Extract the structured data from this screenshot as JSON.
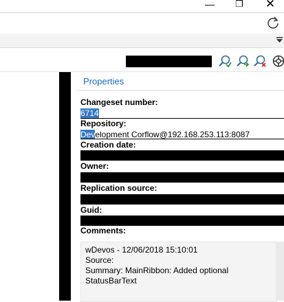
{
  "window": {
    "minimize_glyph": "—",
    "maximize_glyph": "❐",
    "close_glyph": "✕"
  },
  "toolbar": {
    "icons": [
      "find-icon",
      "find-next-icon",
      "find-clear-icon",
      "settings-icon"
    ]
  },
  "properties": {
    "header": "Properties",
    "changeset_label": "Changeset number:",
    "changeset_value": "6714",
    "repository_label": "Repository:",
    "repository_selected": "Dev",
    "repository_value": "elopment Corflow@192.168.253.113:8087",
    "creation_date_label": "Creation date:",
    "owner_label": "Owner:",
    "replication_label": "Replication source:",
    "guid_label": "Guid:",
    "comments_label": "Comments:",
    "comments_text": "wDevos - 12/06/2018 15:10:01\nSource:\nSummary: MainRibbon: Added optional\nStatusBarText"
  },
  "colors": {
    "accent": "#1a6bbf",
    "selection": "#3578c6"
  }
}
